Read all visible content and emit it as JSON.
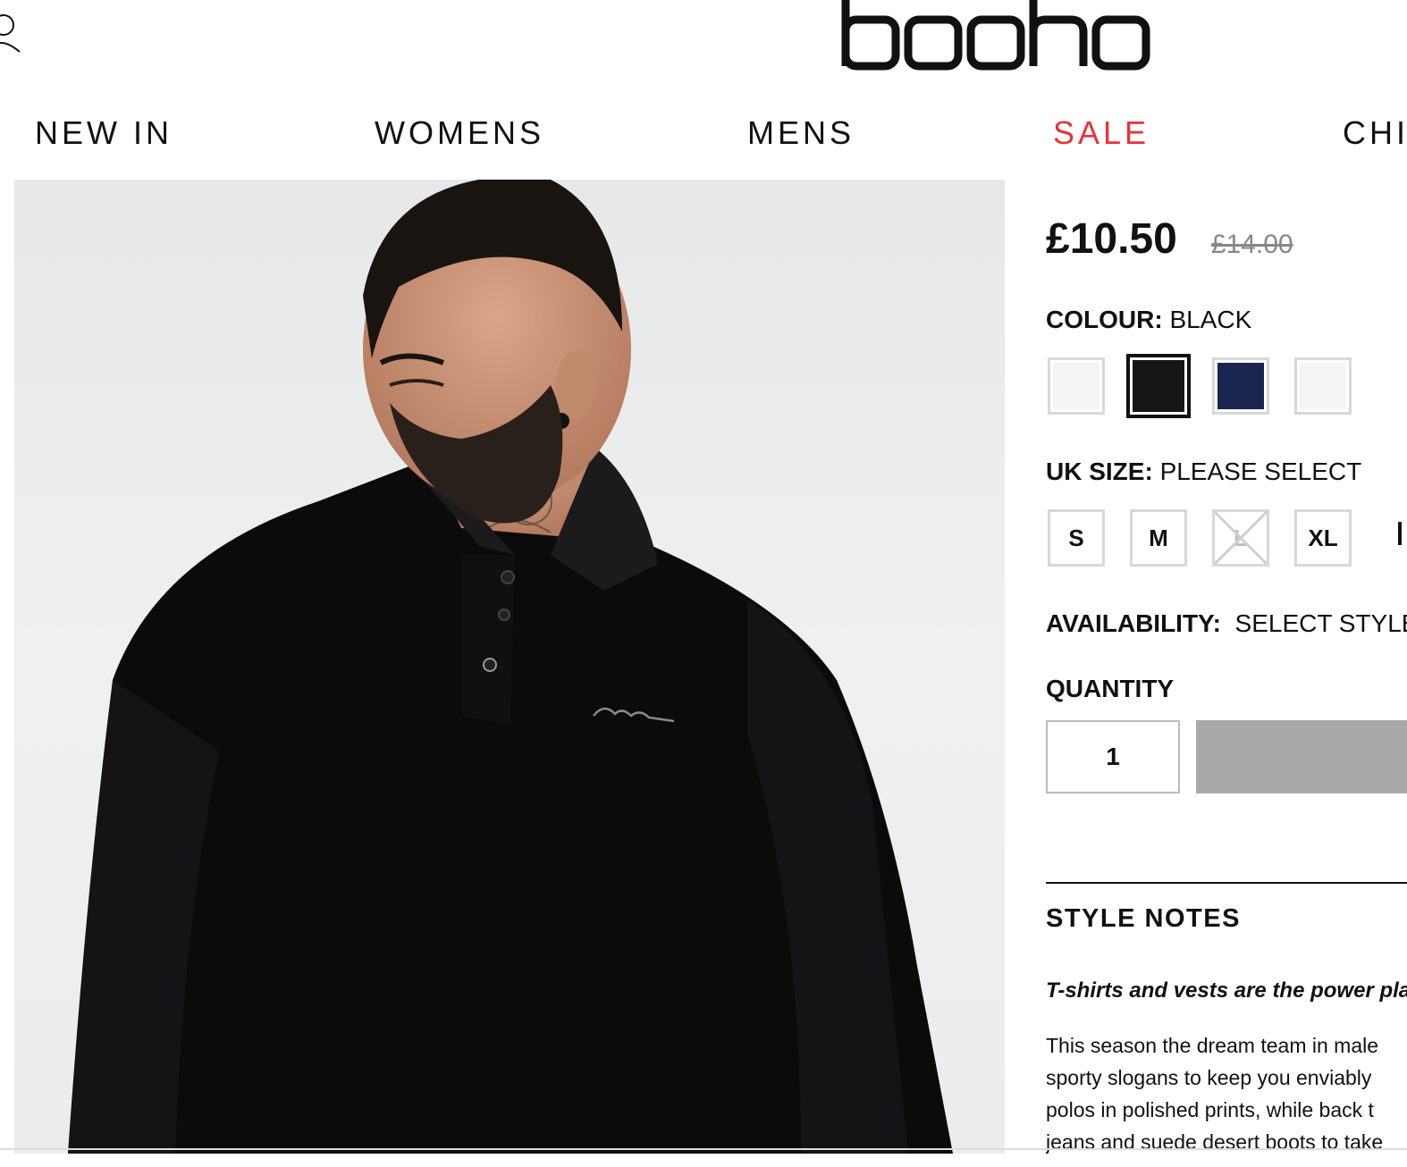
{
  "header": {
    "logo_text": "boohoo",
    "account_icon": "user-icon"
  },
  "nav": {
    "items": [
      {
        "label": "NEW IN"
      },
      {
        "label": "WOMENS"
      },
      {
        "label": "MENS"
      },
      {
        "label": "SALE",
        "color": "#e8323a"
      },
      {
        "label": "CHI"
      }
    ]
  },
  "product": {
    "price_now": "£10.50",
    "price_was": "£14.00",
    "colour_label": "COLOUR:",
    "colour_value": "BLACK",
    "swatches": [
      {
        "color": "#f3f4f6"
      },
      {
        "color": "#161616",
        "selected": true
      },
      {
        "color": "#1b2550"
      },
      {
        "color": "#f4f5f7"
      }
    ],
    "size_label": "UK SIZE:",
    "size_value": "PLEASE SELECT",
    "sizes": [
      {
        "label": "S",
        "available": true
      },
      {
        "label": "M",
        "available": true
      },
      {
        "label": "L",
        "available": false
      },
      {
        "label": "XL",
        "available": true
      }
    ],
    "availability_label": "AVAILABILITY:",
    "availability_value": "SELECT STYLE",
    "quantity_label": "QUANTITY",
    "quantity_value": "1"
  },
  "style_notes": {
    "heading": "STYLE NOTES",
    "lead": "T-shirts and vests are the power pla",
    "body_lines": [
      "This season the dream team in male",
      "sporty slogans to keep you enviably",
      "polos in polished prints, while back t",
      "jeans and suede desert boots to take"
    ]
  }
}
